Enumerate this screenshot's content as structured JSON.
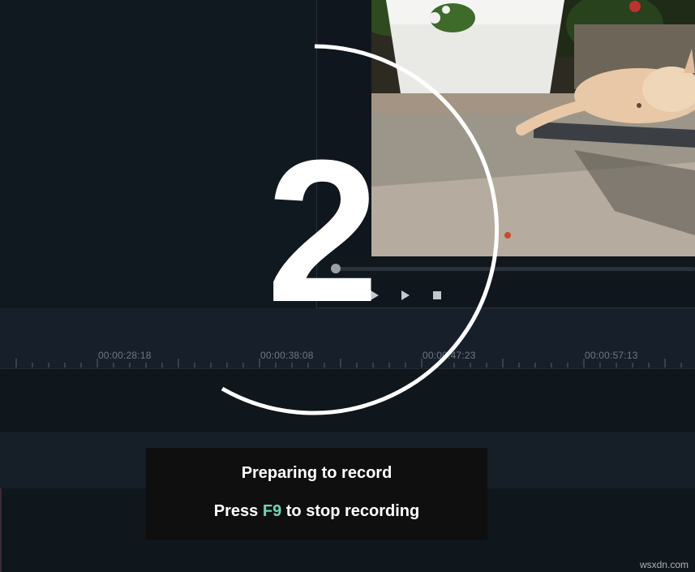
{
  "timeline": {
    "timecodes": [
      "00:00:28:18",
      "00:00:38:08",
      "00:00:47:23",
      "00:00:57:13"
    ]
  },
  "transport": {
    "icons": [
      "play-preview-icon",
      "play-icon",
      "stop-icon"
    ]
  },
  "countdown": {
    "value": "2"
  },
  "recording_notice": {
    "line1": "Preparing to record",
    "line2_prefix": "Press ",
    "hotkey": "F9",
    "line2_suffix": " to stop recording"
  },
  "watermark": "wsxdn.com",
  "colors": {
    "hotkey_accent": "#6fd6b4",
    "background": "#121820",
    "message_box": "#0f0f10"
  }
}
